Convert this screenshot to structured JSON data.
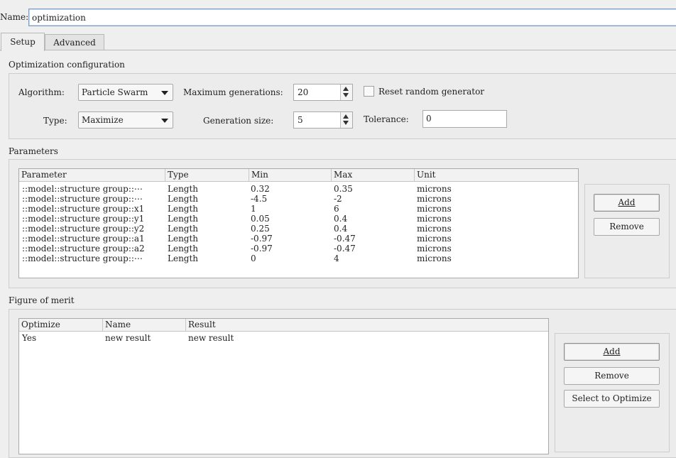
{
  "name_field": {
    "label": "Name:",
    "value": "optimization"
  },
  "tabs": [
    {
      "label": "Setup",
      "active": true
    },
    {
      "label": "Advanced",
      "active": false
    }
  ],
  "optimization_config": {
    "title": "Optimization configuration",
    "algorithm_label": "Algorithm:",
    "algorithm_value": "Particle Swarm",
    "max_generations_label": "Maximum generations:",
    "max_generations_value": "20",
    "reset_random_label": "Reset random generator",
    "reset_random_checked": false,
    "type_label": "Type:",
    "type_value": "Maximize",
    "generation_size_label": "Generation size:",
    "generation_size_value": "5",
    "tolerance_label": "Tolerance:",
    "tolerance_value": "0"
  },
  "parameters": {
    "title": "Parameters",
    "columns": [
      "Parameter",
      "Type",
      "Min",
      "Max",
      "Unit"
    ],
    "rows": [
      [
        "::model::structure group::⋯",
        "Length",
        "0.32",
        "0.35",
        "microns"
      ],
      [
        "::model::structure group::⋯",
        "Length",
        "-4.5",
        "-2",
        "microns"
      ],
      [
        "::model::structure group::x1",
        "Length",
        "1",
        "6",
        "microns"
      ],
      [
        "::model::structure group::y1",
        "Length",
        "0.05",
        "0.4",
        "microns"
      ],
      [
        "::model::structure group::y2",
        "Length",
        "0.25",
        "0.4",
        "microns"
      ],
      [
        "::model::structure group::a1",
        "Length",
        "-0.97",
        "-0.47",
        "microns"
      ],
      [
        "::model::structure group::a2",
        "Length",
        "-0.97",
        "-0.47",
        "microns"
      ],
      [
        "::model::structure group::⋯",
        "Length",
        "0",
        "4",
        "microns"
      ]
    ],
    "add_label": "Add",
    "remove_label": "Remove"
  },
  "figure_of_merit": {
    "title": "Figure of merit",
    "columns": [
      "Optimize",
      "Name",
      "Result"
    ],
    "rows": [
      [
        "Yes",
        "new result",
        "new result"
      ]
    ],
    "add_label": "Add",
    "remove_label": "Remove",
    "select_label": "Select to Optimize"
  }
}
